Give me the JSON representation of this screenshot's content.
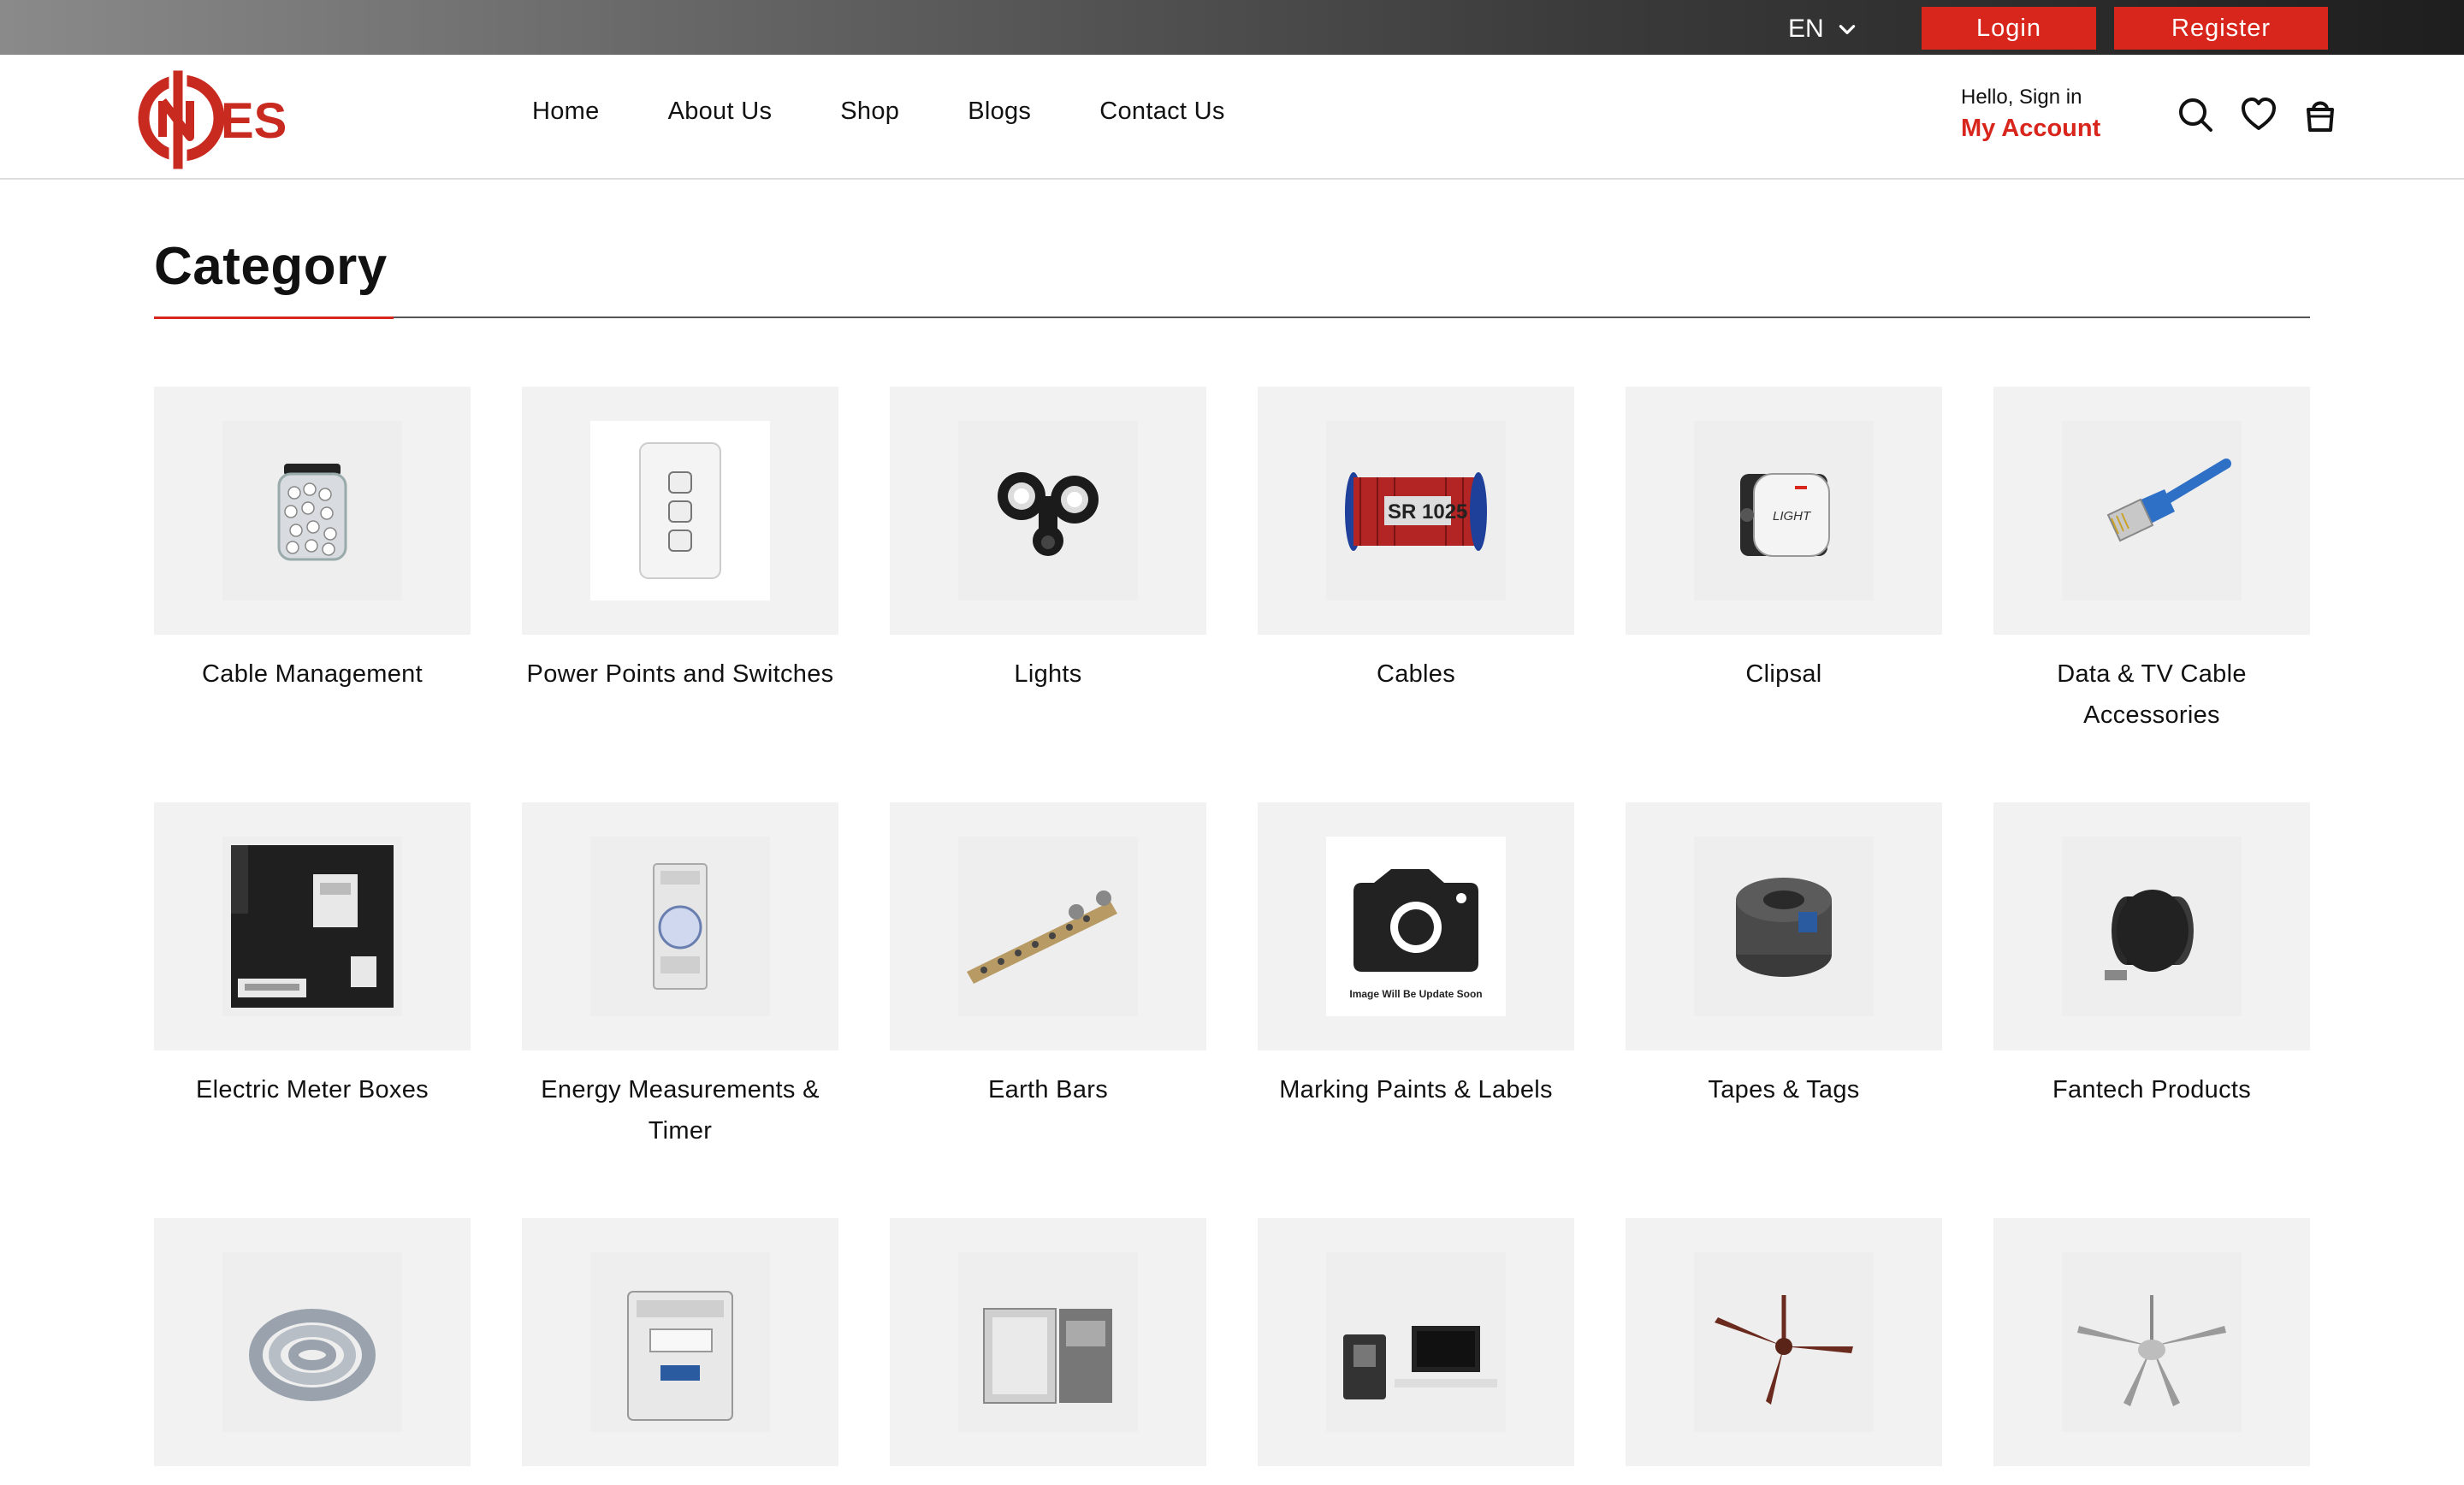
{
  "topbar": {
    "language": "EN",
    "login_label": "Login",
    "register_label": "Register"
  },
  "header": {
    "logo_text": "ES",
    "nav": [
      "Home",
      "About Us",
      "Shop",
      "Blogs",
      "Contact Us"
    ],
    "account": {
      "hello": "Hello, Sign in",
      "link": "My Account"
    },
    "icons": [
      "search-icon",
      "heart-icon",
      "cart-icon"
    ]
  },
  "colors": {
    "brand_red": "#d8261c",
    "tile_bg": "#f2f2f2"
  },
  "category": {
    "title": "Category",
    "items": [
      {
        "label": "Cable Management",
        "image": "cable-management-image"
      },
      {
        "label": "Power Points and Switches",
        "image": "power-points-image"
      },
      {
        "label": "Lights",
        "image": "lights-image"
      },
      {
        "label": "Cables",
        "image": "cables-image"
      },
      {
        "label": "Clipsal",
        "image": "clipsal-image"
      },
      {
        "label": "Data & TV Cable Accessories",
        "image": "data-tv-cable-image"
      },
      {
        "label": "Electric Meter Boxes",
        "image": "electric-meter-box-image"
      },
      {
        "label": "Energy Measurements & Timer",
        "image": "energy-timer-image"
      },
      {
        "label": "Earth Bars",
        "image": "earth-bars-image"
      },
      {
        "label": "Marking Paints & Labels",
        "image": "placeholder-camera-image",
        "placeholder_text": "Image Will Be Update Soon"
      },
      {
        "label": "Tapes & Tags",
        "image": "tapes-image"
      },
      {
        "label": "Fantech Products",
        "image": "fantech-image"
      },
      {
        "label": "",
        "image": "conduit-image"
      },
      {
        "label": "",
        "image": "rcd-breaker-image"
      },
      {
        "label": "",
        "image": "switchboard-image"
      },
      {
        "label": "",
        "image": "intercom-image"
      },
      {
        "label": "",
        "image": "ceiling-fan-brown-image"
      },
      {
        "label": "",
        "image": "ceiling-fan-silver-image"
      }
    ]
  }
}
